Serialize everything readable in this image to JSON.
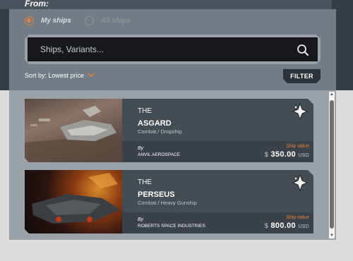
{
  "header": {
    "title": "From:"
  },
  "filters": {
    "radio_my_ships": "My ships",
    "radio_all_ships": "All ships",
    "selected": "My ships"
  },
  "search": {
    "placeholder": "Ships, Variants..."
  },
  "sort": {
    "label": "Sort by: Lowest price"
  },
  "filter_button": {
    "label": "FILTER"
  },
  "ships": [
    {
      "prefix": "THE",
      "name": "ASGARD",
      "role": "Combat / Dropship",
      "by_label": "By",
      "manufacturer": "ANVIL AEROSPACE",
      "value_label": "Ship value",
      "currency_symbol": "$",
      "price": "350.00",
      "currency": "USD"
    },
    {
      "prefix": "THE",
      "name": "PERSEUS",
      "role": "Combat / Heavy Gunship",
      "by_label": "By",
      "manufacturer": "ROBERTS SPACE INDUSTRIES",
      "value_label": "Ship value",
      "currency_symbol": "$",
      "price": "800.00",
      "currency": "USD"
    }
  ],
  "colors": {
    "accent": "#e0813b",
    "panel": "#737c84",
    "card": "#444c54"
  }
}
